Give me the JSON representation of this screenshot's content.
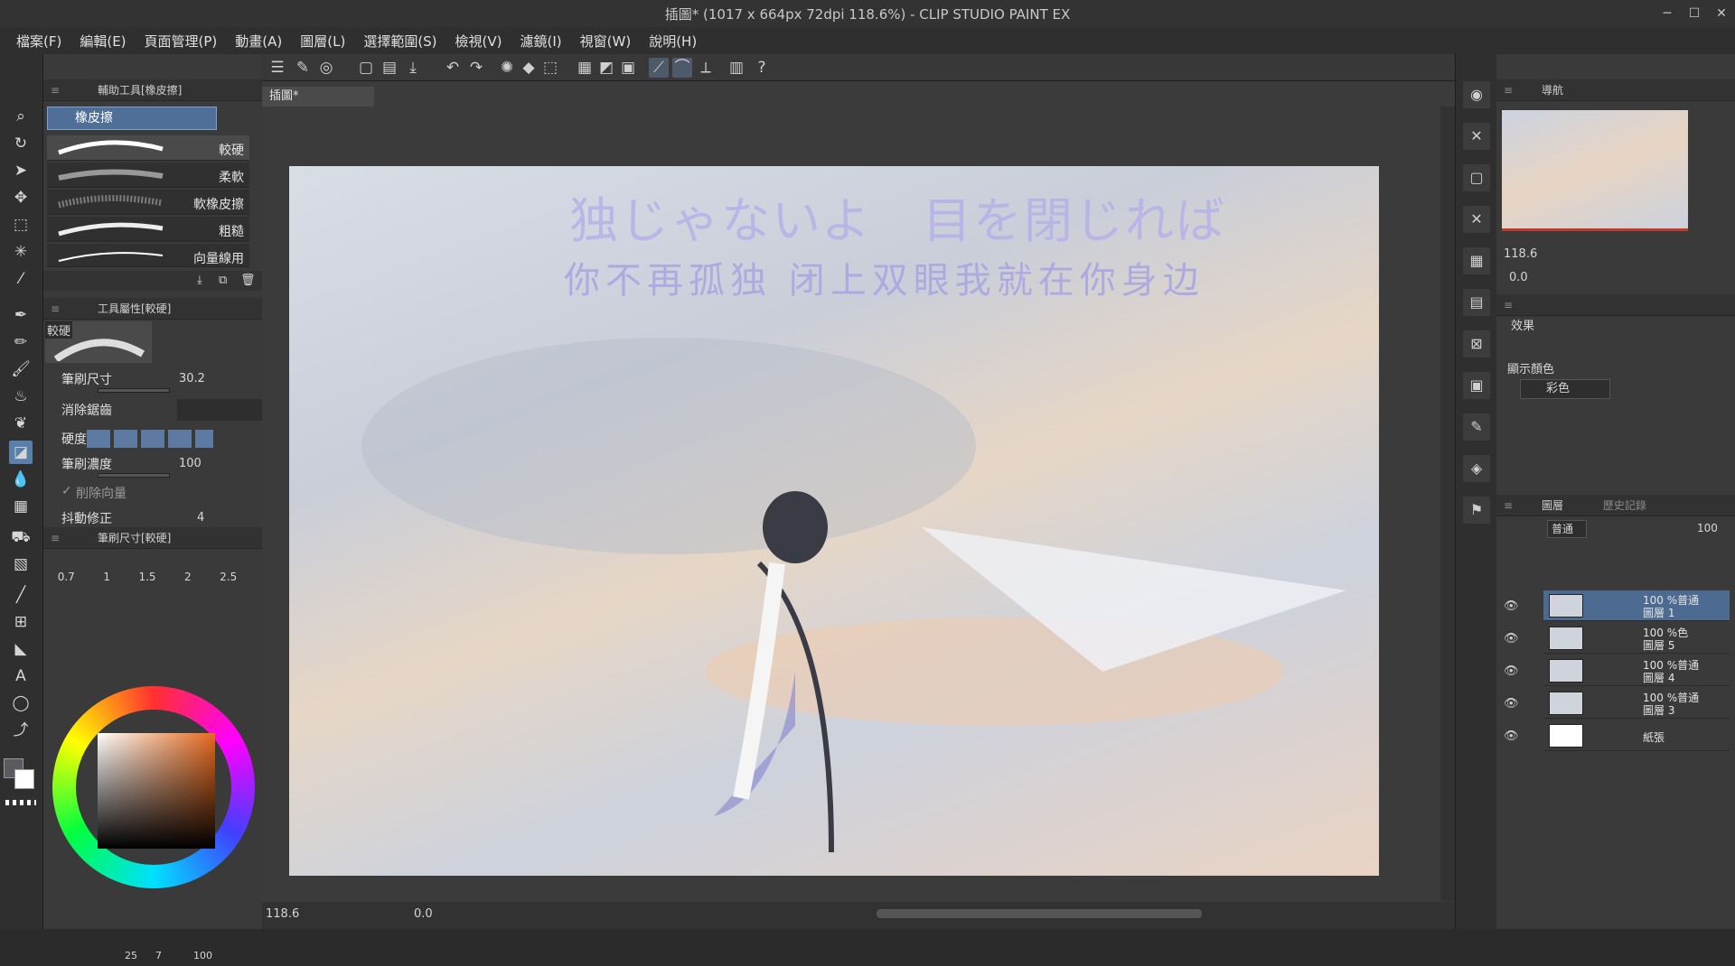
{
  "window": {
    "title": "插圖* (1017 x 664px 72dpi 118.6%)  - CLIP STUDIO PAINT EX",
    "controls": [
      "─",
      "☐",
      "✕"
    ]
  },
  "menu": [
    "檔案(F)",
    "編輯(E)",
    "頁面管理(P)",
    "動畫(A)",
    "圖層(L)",
    "選擇範圍(S)",
    "檢視(V)",
    "濾鏡(I)",
    "視窗(W)",
    "說明(H)"
  ],
  "sub_tool": {
    "title": "輔助工具[橡皮擦]",
    "group": "橡皮擦",
    "brushes": [
      "較硬",
      "柔軟",
      "軟橡皮擦",
      "粗糙",
      "向量線用"
    ]
  },
  "tool_property": {
    "title": "工具屬性[較硬]",
    "preset": "較硬",
    "brush_size_label": "筆刷尺寸",
    "brush_size": "30.2",
    "antialias_label": "消除鋸齒",
    "hardness_label": "硬度",
    "density_label": "筆刷濃度",
    "density": "100",
    "vector_erase_label": "削除向量",
    "stabilization_label": "抖動修正",
    "stabilization": "4"
  },
  "brush_size_panel": {
    "title": "筆刷尺寸[較硬]",
    "sizes": [
      "0.7",
      "1",
      "1.5",
      "2",
      "2.5"
    ]
  },
  "color": {
    "status_h": "25",
    "status_s": "7",
    "status_v": "100"
  },
  "document": {
    "tab": "插圖*",
    "lyric_line1": "独じゃないよ　目を閉じれば",
    "lyric_line2": "你不再孤独 闭上双眼我就在你身边"
  },
  "status": {
    "zoom": "118.6",
    "angle": "0.0"
  },
  "navigator": {
    "title": "導航",
    "zoom": "118.6",
    "angle": "0.0"
  },
  "layer_property": {
    "effect_label": "效果",
    "display_color_label": "顯示顏色",
    "display_color": "彩色"
  },
  "layers_panel": {
    "tab_layers": "圖層",
    "tab_history": "歷史記錄",
    "blend_mode": "普通",
    "opacity": "100"
  },
  "layers": [
    {
      "opacity_mode": "100 %普通",
      "name": "圖層 1"
    },
    {
      "opacity_mode": "100 %色",
      "name": "圖層 5"
    },
    {
      "opacity_mode": "100 %普通",
      "name": "圖層 4"
    },
    {
      "opacity_mode": "100 %普通",
      "name": "圖層 3"
    },
    {
      "opacity_mode": "",
      "name": "紙張"
    }
  ]
}
